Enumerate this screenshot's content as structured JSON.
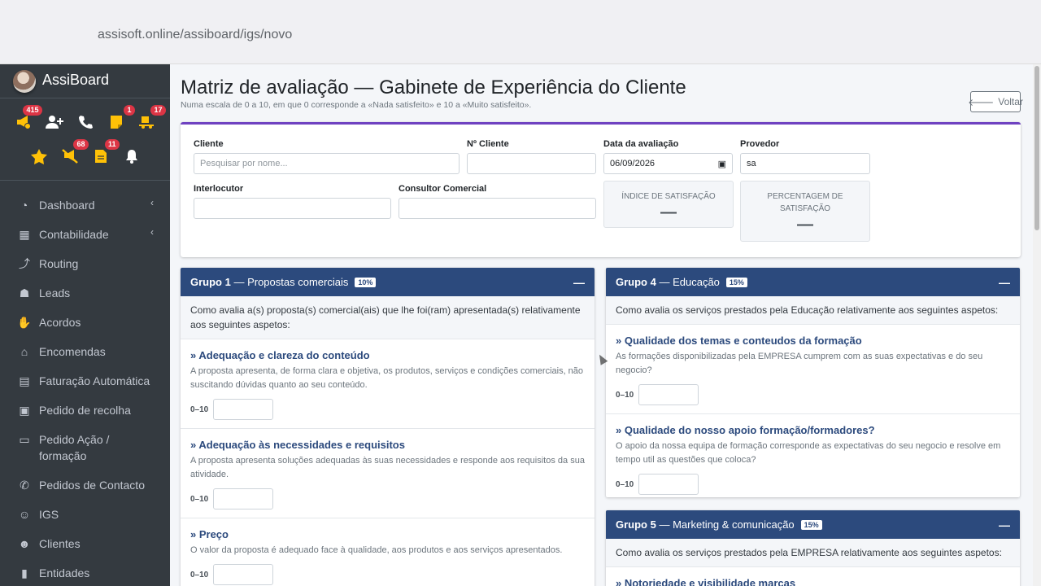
{
  "browser": {
    "url": "assisoft.online/assiboard/igs/novo"
  },
  "sidebar": {
    "brand": "AssiBoard",
    "quick_icons": [
      {
        "icon": "bullhorn-icon",
        "badge": "415"
      },
      {
        "icon": "user-plus-icon",
        "badge": ""
      },
      {
        "icon": "phone-icon",
        "badge": ""
      },
      {
        "icon": "sticky-note-icon",
        "badge": "1"
      },
      {
        "icon": "truck-loading-icon",
        "badge": "17"
      },
      {
        "icon": "star-icon",
        "badge": ""
      },
      {
        "icon": "slash-icon",
        "badge": "68"
      },
      {
        "icon": "file-icon",
        "badge": "11"
      },
      {
        "icon": "bell-icon",
        "badge": ""
      }
    ],
    "items": [
      {
        "label": "Dashboard",
        "icon": "tachometer-icon",
        "chevron": true
      },
      {
        "label": "Contabilidade",
        "icon": "calculator-icon",
        "chevron": true
      },
      {
        "label": "Routing",
        "icon": "route-icon"
      },
      {
        "label": "Leads",
        "icon": "user-plus-icon"
      },
      {
        "label": "Acordos",
        "icon": "handshake-icon"
      },
      {
        "label": "Encomendas",
        "icon": "basket-icon"
      },
      {
        "label": "Faturação Automática",
        "icon": "invoice-icon"
      },
      {
        "label": "Pedido de recolha",
        "icon": "dolly-icon"
      },
      {
        "label": "Pedido Ação / formação",
        "icon": "chalkboard-icon"
      },
      {
        "label": "Pedidos de Contacto",
        "icon": "phone-icon"
      },
      {
        "label": "IGS",
        "icon": "smile-icon"
      },
      {
        "label": "Clientes",
        "icon": "users-icon"
      },
      {
        "label": "Entidades",
        "icon": "address-book-icon"
      }
    ]
  },
  "header": {
    "title": "Matriz de avaliação — Gabinete de Experiência do Cliente",
    "subtitle": "Numa escala de 0 a 10, em que 0 corresponde a «Nada satisfeito» e 10 a «Muito satisfeito».",
    "back_label": "Voltar"
  },
  "form": {
    "cliente_label": "Cliente",
    "cliente_placeholder": "Pesquisar por nome...",
    "ncliente_label": "Nº Cliente",
    "data_label": "Data da avaliação",
    "data_value": "06/09/2026",
    "provedor_label": "Provedor",
    "provedor_value": "sa",
    "interlocutor_label": "Interlocutor",
    "consultor_label": "Consultor Comercial",
    "indice_label": "ÍNDICE DE SATISFAÇÃO",
    "indice_value": "—",
    "percentagem_label": "PERCENTAGEM DE SATISFAÇÃO",
    "percentagem_value": "—"
  },
  "groups": {
    "g1": {
      "num": "Grupo 1",
      "name": "— Propostas comerciais",
      "pct": "10%",
      "toggle": "—",
      "intro": "Como avalia a(s) proposta(s) comercial(ais) que lhe foi(ram) apresentada(s) relativamente aos seguintes aspetos:",
      "questions": [
        {
          "title": "» Adequação e clareza do conteúdo",
          "desc": "A proposta apresenta, de forma clara e objetiva, os produtos, serviços e condições comerciais, não suscitando dúvidas quanto ao seu conteúdo.",
          "scale": "0–10"
        },
        {
          "title": "» Adequação às necessidades e requisitos",
          "desc": "A proposta apresenta soluções adequadas às suas necessidades e responde aos requisitos da sua atividade.",
          "scale": "0–10"
        },
        {
          "title": "» Preço",
          "desc": "O valor da proposta é adequado face à qualidade, aos produtos e aos serviços apresentados.",
          "scale": "0–10"
        }
      ]
    },
    "g4": {
      "num": "Grupo 4",
      "name": "— Educação",
      "pct": "15%",
      "toggle": "—",
      "intro": "Como avalia os serviços prestados pela Educação relativamente aos seguintes aspetos:",
      "questions": [
        {
          "title": "» Qualidade dos temas e conteudos da formação",
          "desc": "As formações disponibilizadas pela EMPRESA cumprem com as suas expectativas e do seu negocio?",
          "scale": "0–10"
        },
        {
          "title": "» Qualidade do nosso apoio formação/formadores?",
          "desc": "O apoio da nossa equipa de formação corresponde as expectativas do seu negocio e resolve em tempo util as questões que coloca?",
          "scale": "0–10"
        }
      ]
    },
    "g5": {
      "num": "Grupo 5",
      "name": "— Marketing & comunicação",
      "pct": "15%",
      "toggle": "—",
      "intro": "Como avalia os serviços prestados pela EMPRESA relativamente aos seguintes aspetos:",
      "questions": [
        {
          "title": "» Notoriedade e visibilidade marcas",
          "desc": "",
          "scale": ""
        }
      ]
    }
  }
}
